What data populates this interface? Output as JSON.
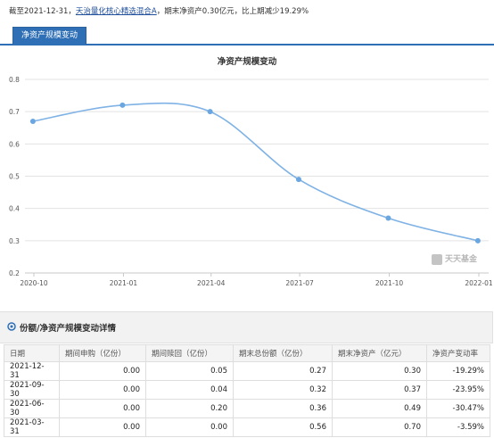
{
  "summary": {
    "prefix": "截至2021-12-31，",
    "fund_name": "天治量化核心精选混合A",
    "suffix": "，期末净资产0.30亿元，比上期减少19.29%"
  },
  "tab": {
    "label": "净资产规模变动"
  },
  "colors": {
    "accent": "#2e6fb5",
    "line": "#7fb2e5",
    "point": "#6aa6e0"
  },
  "chart_data": {
    "type": "line",
    "title": "净资产规模变动",
    "x_ticks": [
      "2020-10",
      "2021-01",
      "2021-04",
      "2021-07",
      "2021-10",
      "2022-01"
    ],
    "x": [
      "2020-12-31",
      "2021-03-31",
      "2021-06-30",
      "2021-09-30",
      "2021-12-31"
    ],
    "series": [
      {
        "values": [
          0.67,
          0.72,
          0.7,
          0.49,
          0.37,
          0.3
        ]
      }
    ],
    "dates": [
      "2020-09-30",
      "2020-12-31",
      "2021-03-31",
      "2021-06-30",
      "2021-09-30",
      "2021-12-31"
    ],
    "y_ticks": [
      "0.8",
      "0.7",
      "0.6",
      "0.5",
      "0.4",
      "0.3",
      "0.2"
    ],
    "ylim": [
      0.2,
      0.8
    ],
    "grid": true,
    "watermark": "天天基金"
  },
  "detail": {
    "title": "份额/净资产规模变动详情",
    "columns": [
      "日期",
      "期间申购（亿份）",
      "期间赎回（亿份）",
      "期末总份额（亿份）",
      "期末净资产（亿元）",
      "净资产变动率"
    ],
    "rows": [
      [
        "2021-12-31",
        "0.00",
        "0.05",
        "0.27",
        "0.30",
        "-19.29%"
      ],
      [
        "2021-09-30",
        "0.00",
        "0.04",
        "0.32",
        "0.37",
        "-23.95%"
      ],
      [
        "2021-06-30",
        "0.00",
        "0.20",
        "0.36",
        "0.49",
        "-30.47%"
      ],
      [
        "2021-03-31",
        "0.00",
        "0.00",
        "0.56",
        "0.70",
        "-3.59%"
      ]
    ]
  }
}
